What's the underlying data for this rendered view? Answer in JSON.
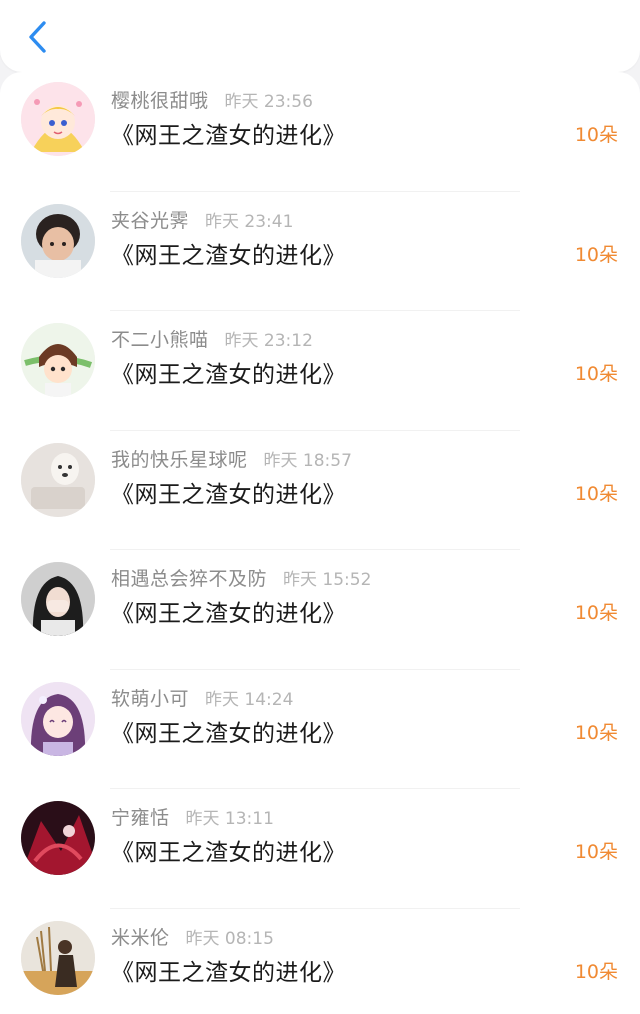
{
  "header": {
    "back_icon": "chevron-left-icon",
    "accent_color": "#2d8cf0"
  },
  "rows": [
    {
      "name": "樱桃很甜哦",
      "time": "昨天 23:56",
      "title": "《网王之渣女的进化》",
      "amount": "10朵"
    },
    {
      "name": "夹谷光霁",
      "time": "昨天 23:41",
      "title": "《网王之渣女的进化》",
      "amount": "10朵"
    },
    {
      "name": "不二小熊喵",
      "time": "昨天 23:12",
      "title": "《网王之渣女的进化》",
      "amount": "10朵"
    },
    {
      "name": "我的快乐星球呢",
      "time": "昨天 18:57",
      "title": "《网王之渣女的进化》",
      "amount": "10朵"
    },
    {
      "name": "相遇总会猝不及防",
      "time": "昨天 15:52",
      "title": "《网王之渣女的进化》",
      "amount": "10朵"
    },
    {
      "name": "软萌小可",
      "time": "昨天 14:24",
      "title": "《网王之渣女的进化》",
      "amount": "10朵"
    },
    {
      "name": "宁雍恬",
      "time": "昨天 13:11",
      "title": "《网王之渣女的进化》",
      "amount": "10朵"
    },
    {
      "name": "米米伦",
      "time": "昨天 08:15",
      "title": "《网王之渣女的进化》",
      "amount": "10朵"
    }
  ],
  "amount_color": "#f08a33"
}
